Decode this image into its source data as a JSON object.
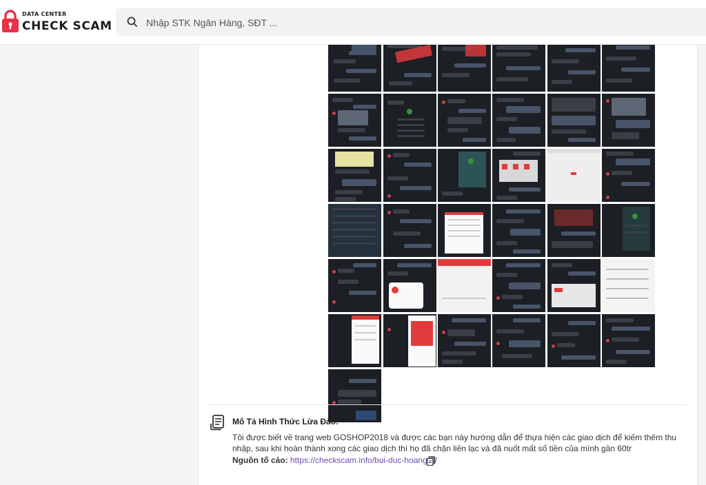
{
  "header": {
    "logo_top": "DATA CENTER",
    "logo_main": "CHECK SCAM",
    "search_placeholder": "Nhập STK Ngân Hàng, SĐT ..."
  },
  "gallery": {
    "rows": 7,
    "columns": 6,
    "visible_images": 37
  },
  "report": {
    "desc_title": "Mô Tả Hình Thức Lừa Đảo:",
    "desc_text": "Tôi được biết về trang web GOSHOP2018 và được các bạn này hướng dẫn để thựa hiện các giao dịch để kiếm thêm thu nhập, sau khi hoàn thành xong các giao dịch thì họ đã chặn liên lạc và đã nuốt mất số tiền của mình gần 60tr",
    "source_label": "Nguồn tố cáo:",
    "source_url": "https://checkscam.info/bui-duc-hoang-3/"
  },
  "colors": {
    "brand": "#e8304a",
    "accent_link": "#6a4db3"
  },
  "icons": [
    "lock-icon",
    "search-icon",
    "document-icon",
    "copy-icon"
  ]
}
